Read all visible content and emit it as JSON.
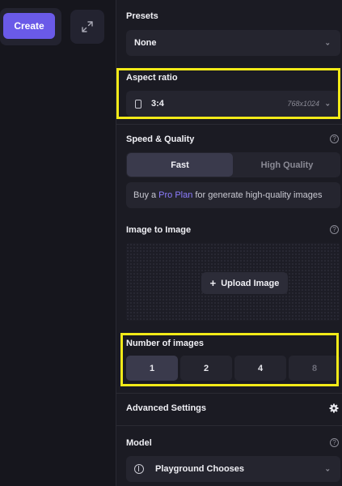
{
  "toolbar": {
    "create_label": "Create"
  },
  "presets": {
    "label": "Presets",
    "value": "None"
  },
  "aspect_ratio": {
    "label": "Aspect ratio",
    "value": "3:4",
    "dimensions": "768x1024"
  },
  "speed_quality": {
    "label": "Speed & Quality",
    "options": [
      "Fast",
      "High Quality"
    ],
    "selected": "Fast",
    "pro_prefix": "Buy a",
    "pro_link": "Pro Plan",
    "pro_suffix": "for generate high-quality images"
  },
  "image_to_image": {
    "label": "Image to Image",
    "upload_label": "Upload Image"
  },
  "number_of_images": {
    "label": "Number of images",
    "options": [
      "1",
      "2",
      "4",
      "8"
    ],
    "selected": "1"
  },
  "advanced_settings": {
    "label": "Advanced Settings"
  },
  "model": {
    "label": "Model",
    "value": "Playground Chooses"
  },
  "help_glyph": "?",
  "colors": {
    "accent": "#6a5ae8",
    "highlight": "#f2ea18",
    "link": "#8d7dff",
    "panel": "#1b1b23",
    "control": "#25252f"
  }
}
